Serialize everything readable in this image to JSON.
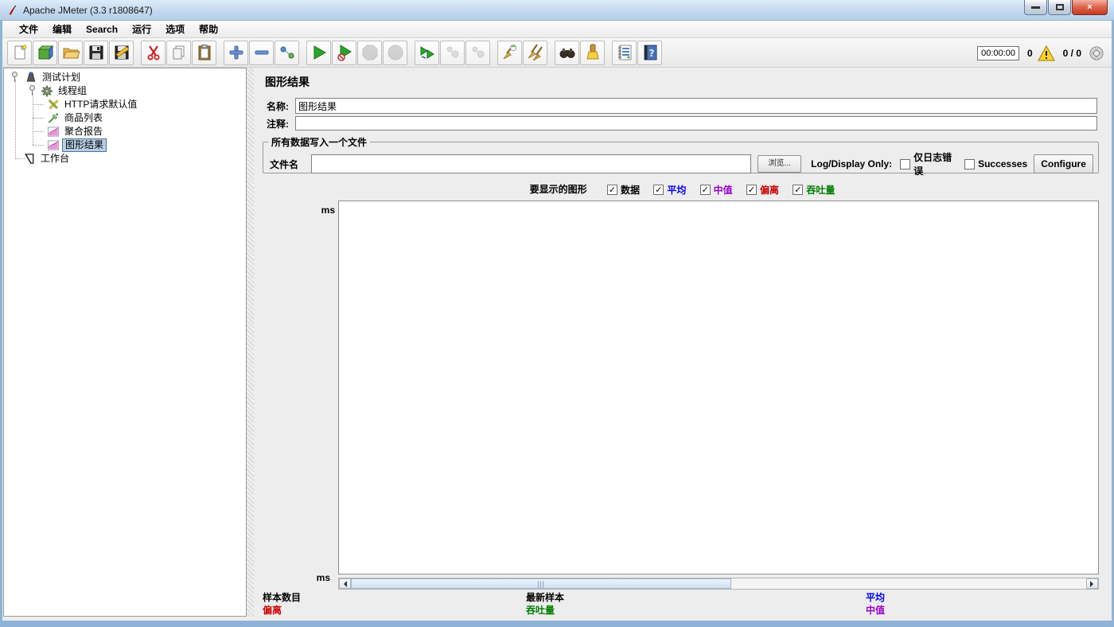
{
  "window": {
    "title": "Apache JMeter (3.3 r1808647)",
    "controls": {
      "minimize": "minimize",
      "maximize": "maximize",
      "close": "close"
    }
  },
  "menu": {
    "items": [
      "文件",
      "编辑",
      "Search",
      "运行",
      "选项",
      "帮助"
    ]
  },
  "toolbar": {
    "buttons": [
      {
        "name": "new",
        "enabled": true
      },
      {
        "name": "templates",
        "enabled": true
      },
      {
        "name": "open",
        "enabled": true
      },
      {
        "name": "save",
        "enabled": true
      },
      {
        "name": "save-as",
        "enabled": true
      },
      {
        "name": "cut",
        "enabled": true
      },
      {
        "name": "copy",
        "enabled": true
      },
      {
        "name": "paste",
        "enabled": true
      },
      {
        "name": "add",
        "enabled": true
      },
      {
        "name": "remove",
        "enabled": true
      },
      {
        "name": "toggle",
        "enabled": true
      },
      {
        "name": "start",
        "enabled": true
      },
      {
        "name": "start-no-timers",
        "enabled": true
      },
      {
        "name": "stop",
        "enabled": false
      },
      {
        "name": "shutdown",
        "enabled": false
      },
      {
        "name": "remote-start-all",
        "enabled": true
      },
      {
        "name": "remote-stop-all",
        "enabled": false
      },
      {
        "name": "remote-shutdown-all",
        "enabled": false
      },
      {
        "name": "clear",
        "enabled": true
      },
      {
        "name": "clear-all",
        "enabled": true
      },
      {
        "name": "search",
        "enabled": true
      },
      {
        "name": "search-reset",
        "enabled": true
      },
      {
        "name": "function-helper",
        "enabled": true
      },
      {
        "name": "help",
        "enabled": true
      }
    ],
    "timer": "00:00:00",
    "error_count": "0",
    "threads": "0 / 0"
  },
  "tree": {
    "items": [
      {
        "label": "测试计划",
        "icon": "test-plan",
        "selected": false
      },
      {
        "label": "线程组",
        "icon": "thread-group",
        "selected": false
      },
      {
        "label": "HTTP请求默认值",
        "icon": "http-defaults",
        "selected": false
      },
      {
        "label": "商品列表",
        "icon": "http-sampler",
        "selected": false
      },
      {
        "label": "聚合报告",
        "icon": "report-chart",
        "selected": false
      },
      {
        "label": "图形结果",
        "icon": "report-chart",
        "selected": true
      },
      {
        "label": "工作台",
        "icon": "workbench",
        "selected": false
      }
    ]
  },
  "main": {
    "title": "图形结果",
    "name_label": "名称:",
    "name_value": "图形结果",
    "comments_label": "注释:",
    "comments_value": "",
    "file_group": {
      "legend": "所有数据写入一个文件",
      "filename_label": "文件名",
      "filename_value": "",
      "browse_button": "浏览...",
      "log_display_label": "Log/Display Only:",
      "errors_only_label": "仅日志错误",
      "errors_only_checked": false,
      "successes_label": "Successes",
      "successes_checked": false,
      "configure_button": "Configure"
    },
    "graphs_row": {
      "label": "要显示的图形",
      "check_glyph": "✓",
      "options": [
        {
          "label": "数据",
          "color": "#000000",
          "checked": true
        },
        {
          "label": "平均",
          "color": "#0000ff",
          "checked": true
        },
        {
          "label": "中值",
          "color": "#9900cc",
          "checked": true
        },
        {
          "label": "偏离",
          "color": "#cc0000",
          "checked": true
        },
        {
          "label": "吞吐量",
          "color": "#008000",
          "checked": true
        }
      ]
    },
    "chart": {
      "y_unit_top": "ms",
      "y_unit_bottom": "ms",
      "samples": []
    },
    "legend": {
      "items": [
        {
          "label": "样本数目",
          "color": "#000000"
        },
        {
          "label": "最新样本",
          "color": "#000000"
        },
        {
          "label": "平均",
          "color": "#0000ff"
        },
        {
          "label": "偏离",
          "color": "#cc0000"
        },
        {
          "label": "吞吐量",
          "color": "#008000"
        },
        {
          "label": "中值",
          "color": "#9900cc"
        }
      ]
    }
  }
}
